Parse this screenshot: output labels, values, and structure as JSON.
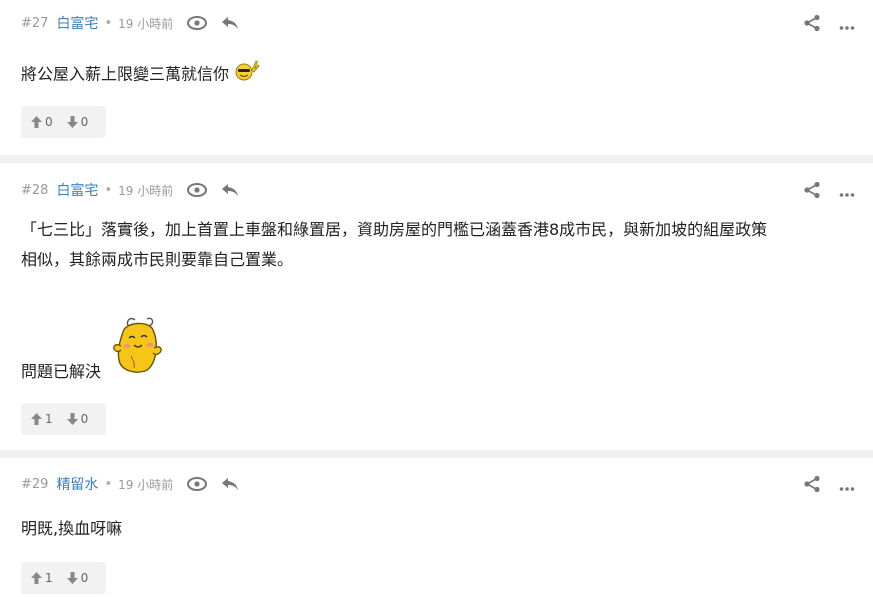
{
  "posts": [
    {
      "number": "#27",
      "author": "白富宅",
      "time": "19 小時前",
      "content": "將公屋入薪上限變三萬就信你",
      "votes_up": "0",
      "votes_down": "0"
    },
    {
      "number": "#28",
      "author": "白富宅",
      "time": "19 小時前",
      "content_line1": "「七三比」落實後，加上首置上車盤和綠置居，資助房屋的門檻已涵蓋香港8成市民，與新加坡的組屋政策",
      "content_line2": "相似，其餘兩成市民則要靠自己置業。",
      "content_line3": "問題已解決",
      "votes_up": "1",
      "votes_down": "0"
    },
    {
      "number": "#29",
      "author": "精留水",
      "time": "19 小時前",
      "content": "明既,換血呀嘛",
      "votes_up": "1",
      "votes_down": "0"
    }
  ],
  "separator": "•",
  "colors": {
    "author": "#3d7fbd",
    "vote_bg": "#f2f2f2",
    "separator_band": "#f0f0f0"
  },
  "icons": [
    "eye-icon",
    "reply-icon",
    "share-icon",
    "more-icon",
    "thumb-up-icon",
    "thumb-down-icon",
    "emoji-sunglasses",
    "emoji-potato"
  ]
}
